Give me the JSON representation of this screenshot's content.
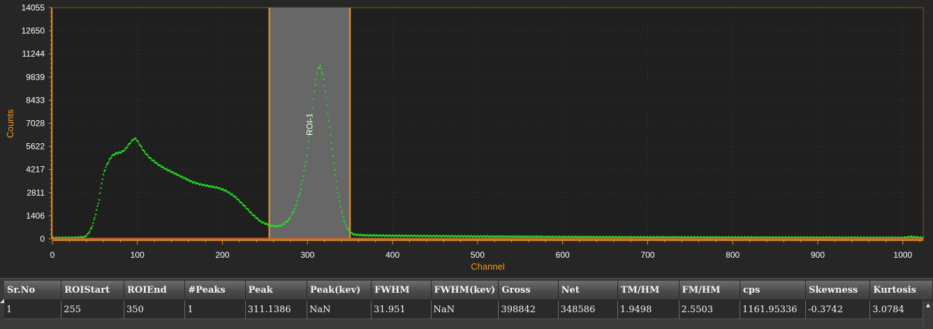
{
  "chart_data": {
    "type": "scatter",
    "xlabel": "Channel",
    "ylabel": "Counts",
    "xlim": [
      0,
      1024
    ],
    "ylim": [
      0,
      14055
    ],
    "x_ticks": [
      0,
      100,
      200,
      300,
      400,
      500,
      600,
      700,
      800,
      900,
      1000
    ],
    "y_ticks": [
      0,
      1406,
      2811,
      4217,
      5622,
      7028,
      8433,
      9839,
      11244,
      12650,
      14055
    ],
    "grid": true,
    "roi": {
      "label": "ROI-1",
      "start": 255,
      "end": 350
    },
    "series_color": "#22dd22",
    "accent_color": "#f59a1b",
    "spectrum": [
      [
        0,
        60
      ],
      [
        30,
        80
      ],
      [
        38,
        120
      ],
      [
        42,
        300
      ],
      [
        46,
        650
      ],
      [
        50,
        1300
      ],
      [
        55,
        2400
      ],
      [
        58,
        3400
      ],
      [
        61,
        4100
      ],
      [
        65,
        4600
      ],
      [
        70,
        5050
      ],
      [
        75,
        5200
      ],
      [
        80,
        5250
      ],
      [
        85,
        5400
      ],
      [
        90,
        5750
      ],
      [
        95,
        6050
      ],
      [
        98,
        6100
      ],
      [
        102,
        5800
      ],
      [
        108,
        5300
      ],
      [
        115,
        4900
      ],
      [
        125,
        4500
      ],
      [
        135,
        4200
      ],
      [
        145,
        3950
      ],
      [
        155,
        3700
      ],
      [
        165,
        3450
      ],
      [
        175,
        3300
      ],
      [
        185,
        3200
      ],
      [
        195,
        3100
      ],
      [
        205,
        2900
      ],
      [
        215,
        2550
      ],
      [
        225,
        2050
      ],
      [
        235,
        1500
      ],
      [
        245,
        1050
      ],
      [
        255,
        830
      ],
      [
        262,
        760
      ],
      [
        270,
        820
      ],
      [
        278,
        1150
      ],
      [
        285,
        1800
      ],
      [
        292,
        3000
      ],
      [
        298,
        4700
      ],
      [
        302,
        6300
      ],
      [
        306,
        8000
      ],
      [
        309,
        9400
      ],
      [
        312,
        10350
      ],
      [
        315,
        10500
      ],
      [
        318,
        10000
      ],
      [
        321,
        9000
      ],
      [
        325,
        7200
      ],
      [
        330,
        5000
      ],
      [
        335,
        3100
      ],
      [
        340,
        1700
      ],
      [
        345,
        800
      ],
      [
        350,
        400
      ],
      [
        355,
        260
      ],
      [
        365,
        220
      ],
      [
        400,
        190
      ],
      [
        450,
        170
      ],
      [
        500,
        150
      ],
      [
        600,
        120
      ],
      [
        700,
        100
      ],
      [
        800,
        90
      ],
      [
        900,
        80
      ],
      [
        1000,
        70
      ],
      [
        1010,
        130
      ],
      [
        1024,
        60
      ]
    ]
  },
  "table": {
    "columns": [
      "Sr.No",
      "ROIStart",
      "ROIEnd",
      "#Peaks",
      "Peak",
      "Peak(kev)",
      "FWHM",
      "FWHM(kev)",
      "Gross",
      "Net",
      "TM/HM",
      "FM/HM",
      "cps",
      "Skewness",
      "Kurtosis"
    ],
    "rows": [
      [
        "1",
        "255",
        "350",
        "1",
        "311.1386",
        "NaN",
        "31.951",
        "NaN",
        "398842",
        "348586",
        "1.9498",
        "2.5503",
        "1161.95336",
        "-0.3742",
        "3.0784"
      ]
    ]
  },
  "icons": {
    "row_marker": "triangle-icon",
    "scroll_up": "scroll-up-arrow-icon"
  }
}
